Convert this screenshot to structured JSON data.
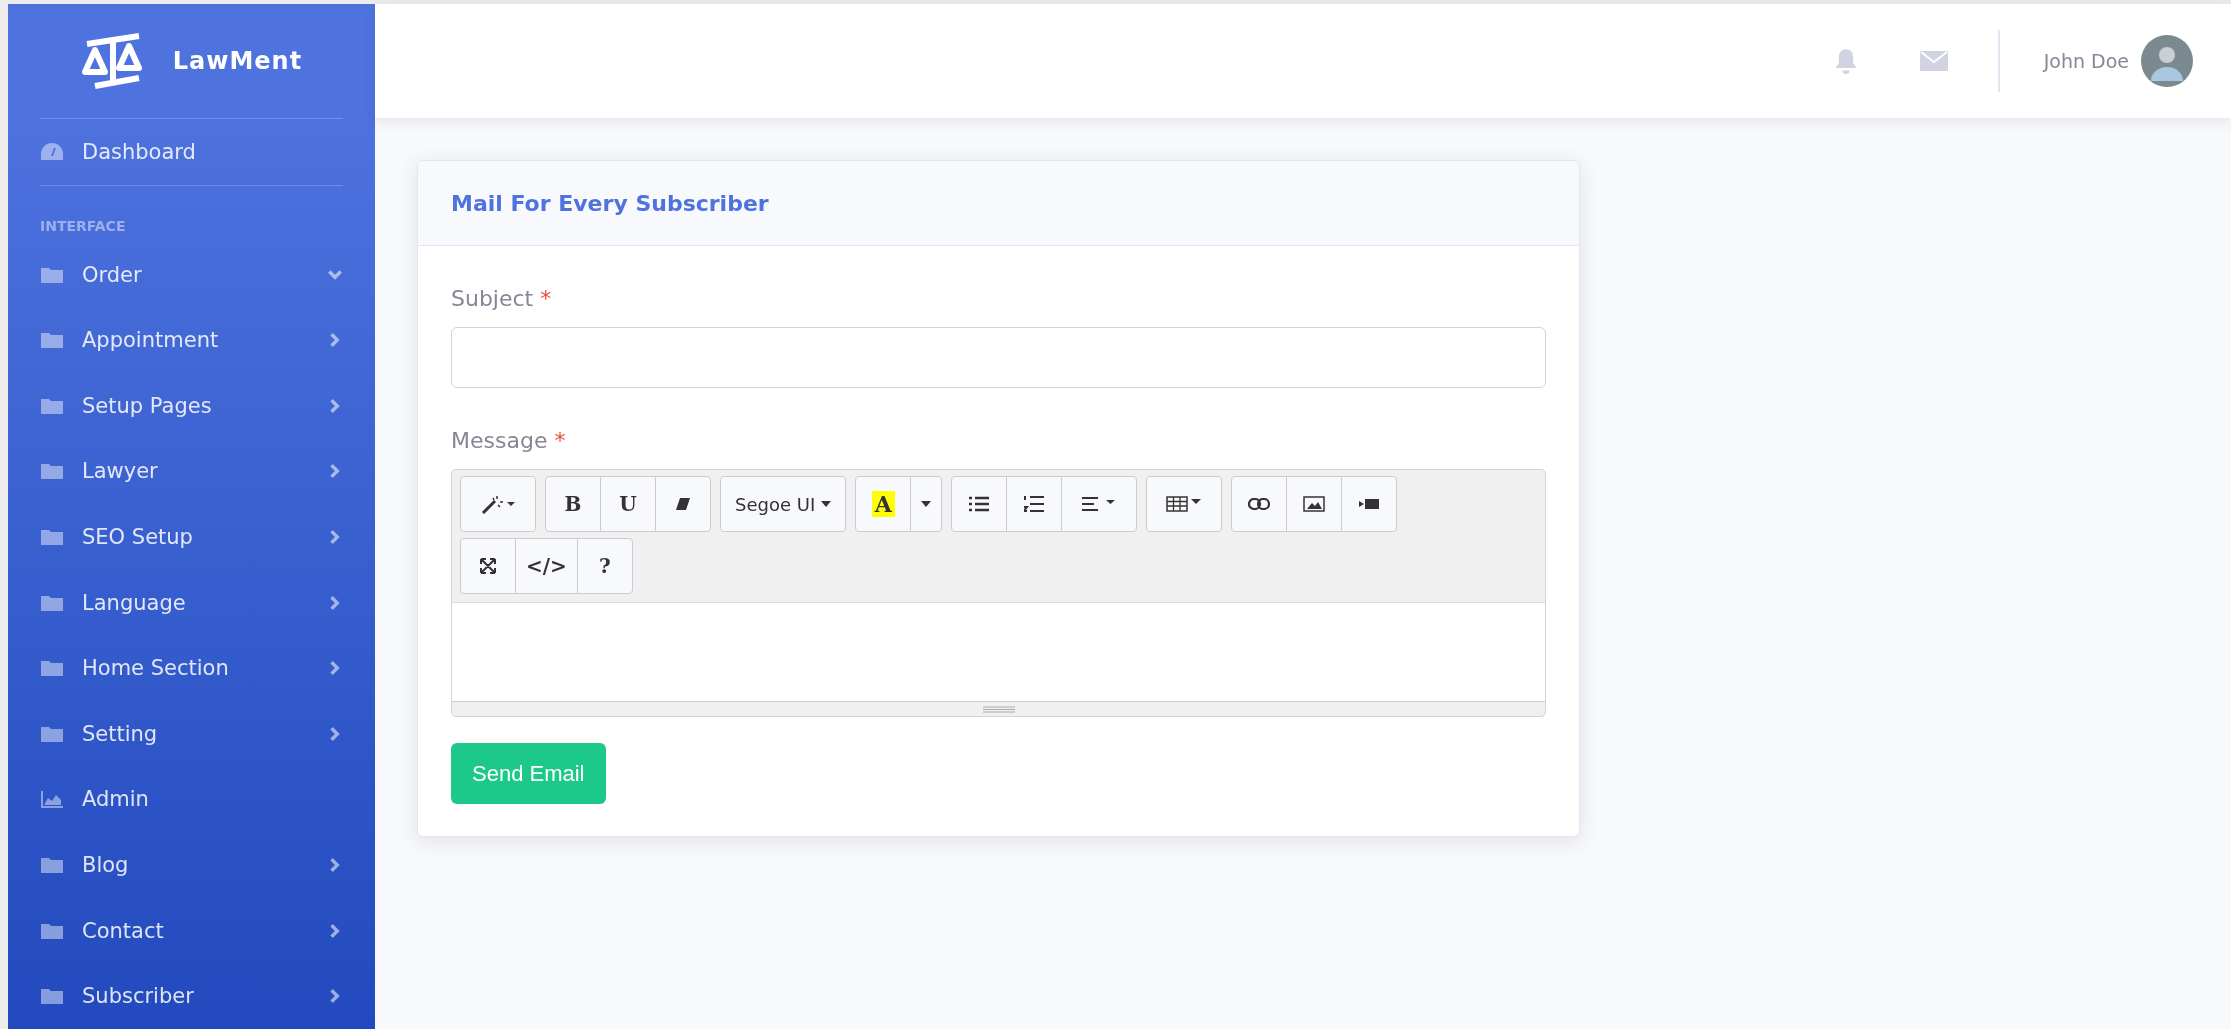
{
  "brand": {
    "name": "LawMent"
  },
  "sidebar": {
    "heading": "INTERFACE",
    "items": [
      {
        "label": "Dashboard",
        "kind": "dashboard"
      },
      {
        "label": "Order",
        "kind": "menu",
        "expanded": true
      },
      {
        "label": "Appointment",
        "kind": "menu",
        "expanded": false
      },
      {
        "label": "Setup Pages",
        "kind": "menu",
        "expanded": false
      },
      {
        "label": "Lawyer",
        "kind": "menu",
        "expanded": false
      },
      {
        "label": "SEO Setup",
        "kind": "menu",
        "expanded": false
      },
      {
        "label": "Language",
        "kind": "menu",
        "expanded": false
      },
      {
        "label": "Home Section",
        "kind": "menu",
        "expanded": false
      },
      {
        "label": "Setting",
        "kind": "menu",
        "expanded": false
      },
      {
        "label": "Admin",
        "kind": "chart"
      },
      {
        "label": "Blog",
        "kind": "menu",
        "expanded": false
      },
      {
        "label": "Contact",
        "kind": "menu",
        "expanded": false
      },
      {
        "label": "Subscriber",
        "kind": "menu",
        "expanded": false
      }
    ]
  },
  "topbar": {
    "user_name": "John Doe"
  },
  "card": {
    "title": "Mail For Every Subscriber",
    "subject": {
      "label": "Subject",
      "required_mark": "*"
    },
    "message": {
      "label": "Message",
      "required_mark": "*"
    },
    "toolbar_rows": [
      [
        [
          {
            "kind": "magic"
          }
        ],
        [
          {
            "kind": "text",
            "label": "B"
          },
          {
            "kind": "text",
            "label": "U"
          },
          {
            "kind": "eraser"
          }
        ],
        [
          {
            "kind": "font",
            "label": "Segoe UI"
          }
        ],
        [
          {
            "kind": "color",
            "label": "A"
          },
          {
            "kind": "caret"
          }
        ],
        [
          {
            "kind": "ul"
          },
          {
            "kind": "ol"
          },
          {
            "kind": "align"
          }
        ],
        [
          {
            "kind": "table"
          }
        ],
        [
          {
            "kind": "link"
          },
          {
            "kind": "picture"
          },
          {
            "kind": "video"
          }
        ]
      ],
      [
        [
          {
            "kind": "fullscreen"
          },
          {
            "kind": "text",
            "label": "</>"
          },
          {
            "kind": "text",
            "label": "?"
          }
        ]
      ]
    ],
    "send_button": "Send Email"
  }
}
